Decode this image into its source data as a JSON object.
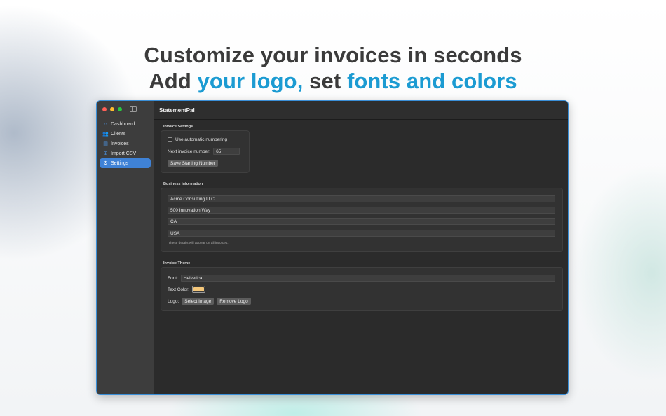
{
  "headline": {
    "line1": "Customize your invoices in seconds",
    "line2_prefix": "Add ",
    "line2_logo": "your logo,",
    "line2_mid": " set ",
    "line2_fonts": "fonts and colors"
  },
  "window": {
    "title": "StatementPal"
  },
  "sidebar": {
    "items": [
      {
        "label": "Dashboard",
        "icon": "house-icon"
      },
      {
        "label": "Clients",
        "icon": "people-icon"
      },
      {
        "label": "Invoices",
        "icon": "document-icon"
      },
      {
        "label": "Import CSV",
        "icon": "tray-icon"
      },
      {
        "label": "Settings",
        "icon": "gear-icon",
        "active": true
      }
    ]
  },
  "invoice_settings": {
    "section_title": "Invoice Settings",
    "auto_numbering_label": "Use automatic numbering",
    "auto_numbering_checked": false,
    "next_number_label": "Next invoice number:",
    "next_number_value": "65",
    "save_button": "Save Starting Number"
  },
  "business_info": {
    "section_title": "Business Information",
    "name": "Acme Consulting LLC",
    "address": "500 Innovation Way",
    "state": "CA",
    "country": "USA",
    "note": "These details will appear on all invoices."
  },
  "invoice_theme": {
    "section_title": "Invoice Theme",
    "font_label": "Font:",
    "font_value": "Helvetica",
    "text_color_label": "Text Color:",
    "text_color": "#f4c77a",
    "logo_label": "Logo:",
    "select_image_button": "Select Image",
    "remove_logo_button": "Remove Logo"
  },
  "colors": {
    "accent": "#3f82d6",
    "headline_highlight": "#1b9bd2"
  }
}
